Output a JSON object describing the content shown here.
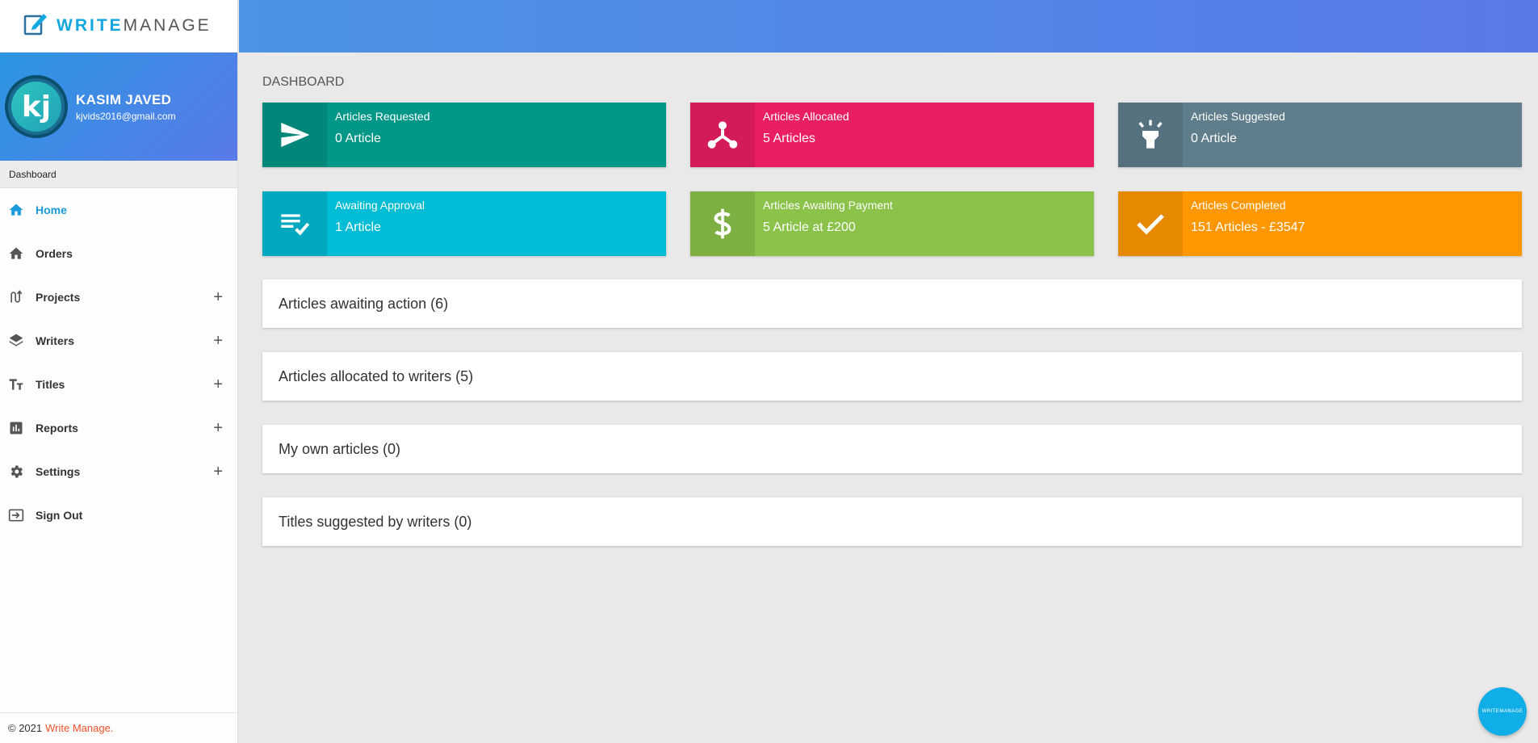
{
  "brand": {
    "part1": "WRITE",
    "part2": "MANAGE"
  },
  "user": {
    "initials": "kj",
    "name": "KASIM JAVED",
    "email": "kjvids2016@gmail.com"
  },
  "sidebar": {
    "section_label": "Dashboard",
    "items": [
      {
        "label": "Home",
        "icon": "home-icon",
        "active": true,
        "expandable": false
      },
      {
        "label": "Orders",
        "icon": "home-icon",
        "active": false,
        "expandable": false
      },
      {
        "label": "Projects",
        "icon": "route-icon",
        "active": false,
        "expandable": true
      },
      {
        "label": "Writers",
        "icon": "layers-icon",
        "active": false,
        "expandable": true
      },
      {
        "label": "Titles",
        "icon": "text-size-icon",
        "active": false,
        "expandable": true
      },
      {
        "label": "Reports",
        "icon": "bar-chart-icon",
        "active": false,
        "expandable": true
      },
      {
        "label": "Settings",
        "icon": "gear-icon",
        "active": false,
        "expandable": true
      },
      {
        "label": "Sign Out",
        "icon": "sign-in-icon",
        "active": false,
        "expandable": false
      }
    ],
    "plus": "+"
  },
  "footer": {
    "copyright": "© 2021",
    "brand": "Write Manage."
  },
  "page": {
    "title": "DASHBOARD"
  },
  "cards": [
    {
      "title": "Articles Requested",
      "value": "0 Article",
      "icon": "send-icon",
      "color": "#009688",
      "icon_color": "#00877a"
    },
    {
      "title": "Articles Allocated",
      "value": "5 Articles",
      "icon": "fork-icon",
      "color": "#e91e63",
      "icon_color": "#d31b59"
    },
    {
      "title": "Articles Suggested",
      "value": "0 Article",
      "icon": "lightbulb-icon",
      "color": "#607d8b",
      "icon_color": "#56717e"
    },
    {
      "title": "Awaiting Approval",
      "value": "1 Article",
      "icon": "playlist-check-icon",
      "color": "#00bcd4",
      "icon_color": "#00a9bf"
    },
    {
      "title": "Articles Awaiting Payment",
      "value": "5 Article at £200",
      "icon": "dollar-icon",
      "color": "#8bc34a",
      "icon_color": "#7daf42"
    },
    {
      "title": "Articles Completed",
      "value": "151 Articles - £3547",
      "icon": "check-icon",
      "color": "#ff9800",
      "icon_color": "#e58900"
    }
  ],
  "panels": [
    {
      "label": "Articles awaiting action (6)"
    },
    {
      "label": "Articles allocated to writers (5)"
    },
    {
      "label": "My own articles (0)"
    },
    {
      "label": "Titles suggested by writers (0)"
    }
  ],
  "fab": {
    "label": "WRITEMANAGE"
  }
}
